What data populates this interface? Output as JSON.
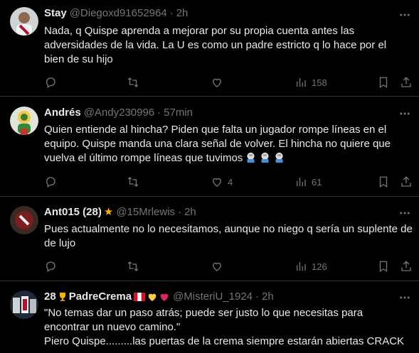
{
  "tweets": [
    {
      "name": "Stay",
      "handle": "@Diegoxd91652964",
      "dot": "·",
      "time": "2h",
      "lines": [
        "Nada, q Quispe aprenda a mejorar por su propia cuenta antes las",
        "adversidades de la vida. La U es como un padre estricto q lo hace por el",
        "bien de su hijo"
      ],
      "reply_count": "",
      "retweet_count": "",
      "like_count": "",
      "views_count": "158"
    },
    {
      "name": "Andrés",
      "handle": "@Andy230996",
      "dot": "·",
      "time": "57min",
      "lines": [
        "Quien entiende al hincha? Piden que falta un jugador rompe líneas en el",
        "equipo. Quispe manda una clara señal de volver. El hincha no quiere que",
        "vuelva el último rompe líneas que tuvimos"
      ],
      "reply_count": "",
      "retweet_count": "",
      "like_count": "4",
      "views_count": "61"
    },
    {
      "name": "Ant015 (28)",
      "handle": "@15Mrlewis",
      "dot": "·",
      "time": "2h",
      "lines": [
        "Pues actualmente no lo necesitamos, aunque no niego q sería un suplente de",
        "de lujo"
      ],
      "reply_count": "",
      "retweet_count": "",
      "like_count": "",
      "views_count": "126"
    },
    {
      "name": "28",
      "name2": "PadreCrema",
      "handle": "@MisteriU_1924",
      "dot": "·",
      "time": "2h",
      "lines": [
        "\"No temas dar un paso atrás; puede ser justo lo que necesitas para",
        "encontrar un nuevo camino.\"",
        "Piero Quispe.........las puertas de la crema siempre estarán abiertas CRACK"
      ]
    }
  ],
  "icons": [
    "reply-icon",
    "retweet-icon",
    "like-icon",
    "views-icon",
    "bookmark-icon",
    "share-icon",
    "more-icon"
  ]
}
